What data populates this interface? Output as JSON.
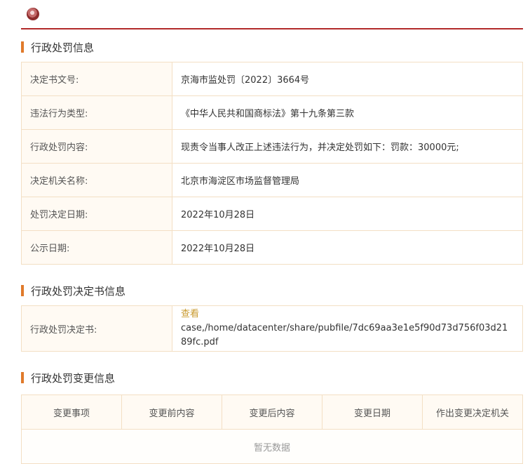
{
  "section1": {
    "title": "行政处罚信息",
    "rows": [
      {
        "label": "决定书文号:",
        "value": "京海市监处罚〔2022〕3664号"
      },
      {
        "label": "违法行为类型:",
        "value": "《中华人民共和国商标法》第十九条第三款"
      },
      {
        "label": "行政处罚内容:",
        "value": "现责令当事人改正上述违法行为，并决定处罚如下：罚款：30000元;"
      },
      {
        "label": "决定机关名称:",
        "value": "北京市海淀区市场监督管理局"
      },
      {
        "label": "处罚决定日期:",
        "value": "2022年10月28日"
      },
      {
        "label": "公示日期:",
        "value": "2022年10月28日"
      }
    ]
  },
  "section2": {
    "title": "行政处罚决定书信息",
    "label": "行政处罚决定书:",
    "link_text": "查看",
    "path_line1": "case,/home/datacenter/share/pubfile/7dc69aa3e1e5f90d73d756f03d21",
    "path_line2": "89fc.pdf"
  },
  "section3": {
    "title": "行政处罚变更信息",
    "columns": [
      "变更事项",
      "变更前内容",
      "变更后内容",
      "变更日期",
      "作出变更决定机关"
    ],
    "empty_text": "暂无数据"
  },
  "colors": {
    "accent": "#e07a2b",
    "rule": "#b22a2a",
    "link": "#c99a2e"
  }
}
